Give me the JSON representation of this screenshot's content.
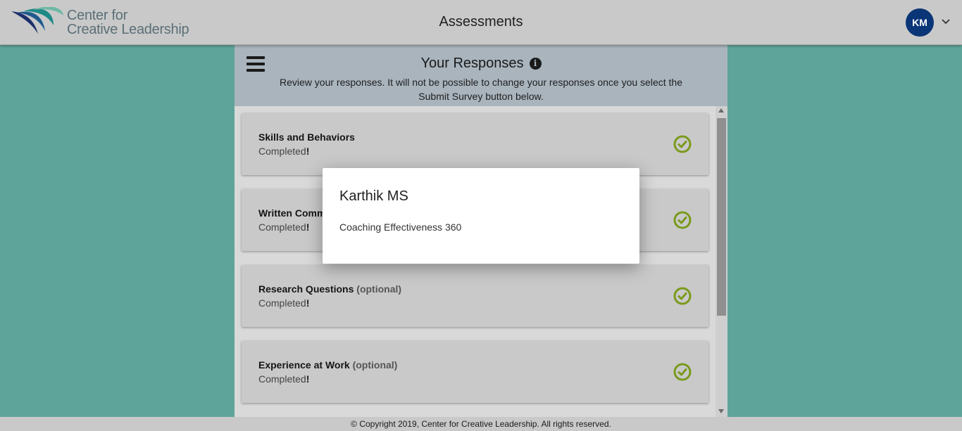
{
  "header": {
    "logo_line1": "Center for",
    "logo_line2": "Creative Leadership",
    "title": "Assessments",
    "avatar_initials": "KM"
  },
  "panel": {
    "title": "Your Responses",
    "subtitle": "Review your responses. It will not be possible to change your responses once you select the Submit Survey button below."
  },
  "sections": [
    {
      "title": "Skills and Behaviors",
      "optional_label": "",
      "status": "Completed",
      "status_suffix": "!"
    },
    {
      "title": "Written Comm",
      "optional_label": "",
      "status": "Completed",
      "status_suffix": "!"
    },
    {
      "title": "Research Questions",
      "optional_label": "(optional)",
      "status": "Completed",
      "status_suffix": "!"
    },
    {
      "title": "Experience at Work",
      "optional_label": "(optional)",
      "status": "Completed",
      "status_suffix": "!"
    }
  ],
  "modal": {
    "title": "Karthik MS",
    "body": "Coaching Effectiveness 360"
  },
  "footer": {
    "copyright": "© Copyright 2019, Center for Creative Leadership. All rights reserved."
  },
  "colors": {
    "background": "#5fa49b",
    "avatar": "#0a3577",
    "check": "#7a9a1c",
    "panel_header": "#a9b4bd"
  },
  "icons": {
    "menu": "hamburger-icon",
    "info": "info-icon",
    "complete": "check-circle-icon",
    "account": "chevron-down-icon"
  }
}
